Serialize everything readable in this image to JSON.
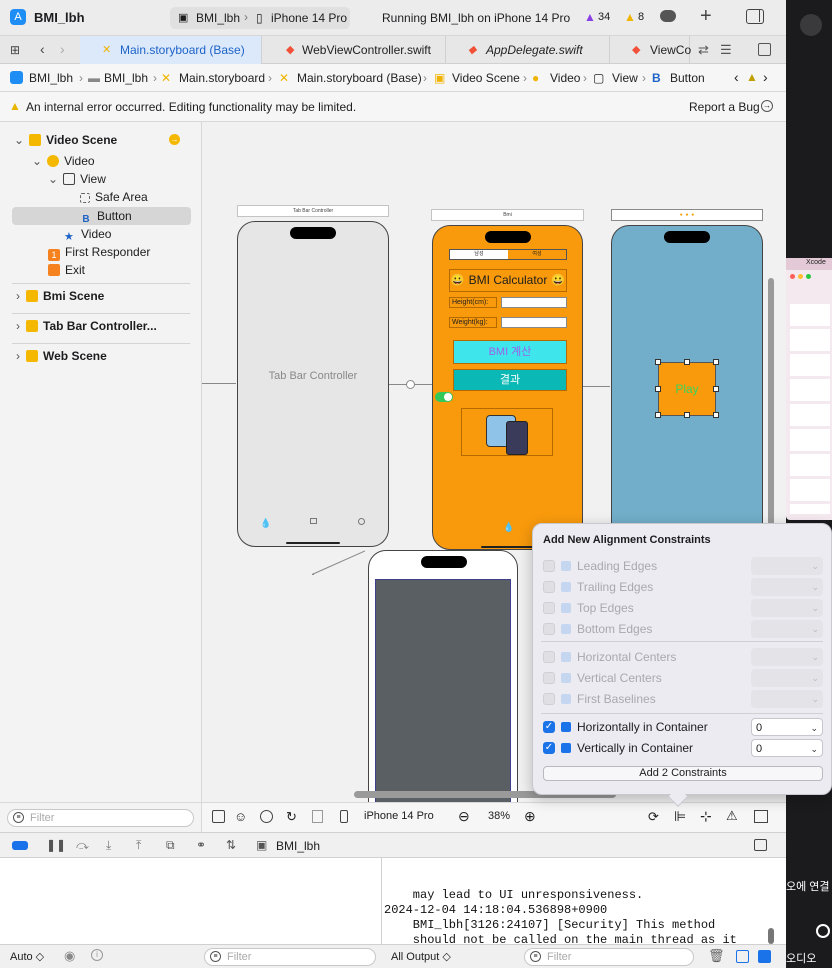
{
  "app": {
    "project_name": "BMI_lbh"
  },
  "toolbar": {
    "scheme": "BMI_lbh",
    "device": "iPhone 14 Pro",
    "status": "Running BMI_lbh on iPhone 14 Pro",
    "warnings_count": "34",
    "errors_count": "8",
    "add_label": "+"
  },
  "tabs": [
    {
      "label": "Main.storyboard (Base)"
    },
    {
      "label": "WebViewController.swift"
    },
    {
      "label": "AppDelegate.swift"
    },
    {
      "label": "ViewCo"
    }
  ],
  "breadcrumb": [
    "BMI_lbh",
    "BMI_lbh",
    "Main.storyboard",
    "Main.storyboard (Base)",
    "Video Scene",
    "Video",
    "View",
    "Button"
  ],
  "warning": {
    "message": "An internal error occurred. Editing functionality may be limited.",
    "report": "Report a Bug"
  },
  "outline": {
    "items": [
      {
        "label": "Video Scene"
      },
      {
        "label": "Video"
      },
      {
        "label": "View"
      },
      {
        "label": "Safe Area"
      },
      {
        "label": "Button"
      },
      {
        "label": "Video"
      },
      {
        "label": "First Responder"
      },
      {
        "label": "Exit"
      },
      {
        "label": "Bmi Scene"
      },
      {
        "label": "Tab Bar Controller..."
      },
      {
        "label": "Web Scene"
      }
    ],
    "filter_placeholder": "Filter"
  },
  "canvas": {
    "tabbar_scene_title": "Tab Bar Controller",
    "tabbar_center_label": "Tab Bar Controller",
    "bmi_scene_title": "Bmi",
    "bmi": {
      "segment_left": "남성",
      "segment_right": "여성",
      "title": "😀 BMI Calculator 😀",
      "height_label": "Height(cm):",
      "weight_label": "Weight(kg):",
      "calc_button": "BMI 계산",
      "result_label": "결과"
    },
    "video": {
      "play_button": "Play"
    },
    "device_label": "iPhone 14 Pro",
    "zoom": "38%"
  },
  "popover": {
    "title": "Add New Alignment Constraints",
    "rows": [
      {
        "label": "Leading Edges",
        "checked": false,
        "value": ""
      },
      {
        "label": "Trailing Edges",
        "checked": false,
        "value": ""
      },
      {
        "label": "Top Edges",
        "checked": false,
        "value": ""
      },
      {
        "label": "Bottom Edges",
        "checked": false,
        "value": ""
      },
      {
        "label": "Horizontal Centers",
        "checked": false,
        "value": ""
      },
      {
        "label": "Vertical Centers",
        "checked": false,
        "value": ""
      },
      {
        "label": "First Baselines",
        "checked": false,
        "value": ""
      },
      {
        "label": "Horizontally in Container",
        "checked": true,
        "value": "0"
      },
      {
        "label": "Vertically in Container",
        "checked": true,
        "value": "0"
      }
    ],
    "add_button": "Add 2 Constraints"
  },
  "debug": {
    "target": "BMI_lbh",
    "console_text": "    may lead to UI unresponsiveness.\n2024-12-04 14:18:04.536898+0900\n    BMI_lbh[3126:24107] [Security] This method\n    should not be called on the main thread as it\n    may lead to UI unresponsiveness.",
    "auto_label": "Auto ◇",
    "filter_placeholder": "Filter",
    "output_label": "All Output ◇",
    "console_filter_placeholder": "Filter"
  },
  "desktop": {
    "xcode_label": "Xcode",
    "korean_1": "오에 연결",
    "korean_2": "오디오"
  },
  "colors": {
    "accent": "#1a73e8",
    "bmi_orange": "#f99a0c",
    "video_blue": "#72aec9",
    "cyan_button": "#3ee6ec",
    "teal_button": "#0ab9b6"
  }
}
